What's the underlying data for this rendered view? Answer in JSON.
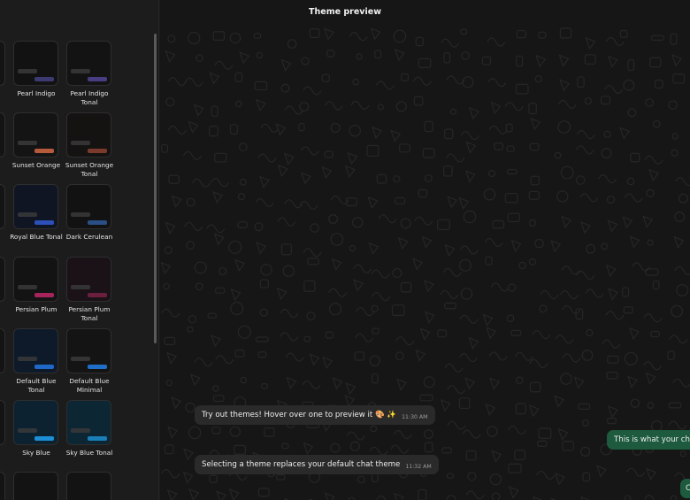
{
  "header": {
    "title": "Theme preview"
  },
  "themes": [
    {
      "label": "Pearl Indigo",
      "label2": "",
      "bg": "#121212",
      "accent": "#3d3a72",
      "col": 1,
      "row": 0
    },
    {
      "label": "Pearl Indigo",
      "label2": "Tonal",
      "bg": "#131313",
      "accent": "#463e80",
      "col": 2,
      "row": 0
    },
    {
      "label": "Sunset Orange",
      "label2": "",
      "bg": "#141414",
      "accent": "#b55a3b",
      "col": 1,
      "row": 1
    },
    {
      "label": "Sunset Orange",
      "label2": "Tonal",
      "bg": "#151212",
      "accent": "#7a3b2c",
      "col": 2,
      "row": 1
    },
    {
      "label": "Royal Blue Tonal",
      "label2": "",
      "bg": "#101524",
      "accent": "#2c4fb8",
      "col": 1,
      "row": 2
    },
    {
      "label": "Dark Cerulean",
      "label2": "",
      "bg": "#121212",
      "accent": "#2a4f85",
      "col": 2,
      "row": 2
    },
    {
      "label": "Persian Plum",
      "label2": "",
      "bg": "#131313",
      "accent": "#a5245c",
      "col": 1,
      "row": 3
    },
    {
      "label": "Persian Plum",
      "label2": "Tonal",
      "bg": "#1a1216",
      "accent": "#6a1f3e",
      "col": 2,
      "row": 3
    },
    {
      "label": "Default Blue",
      "label2": "Tonal",
      "bg": "#0e1a2a",
      "accent": "#1f67c8",
      "col": 1,
      "row": 4
    },
    {
      "label": "Default Blue",
      "label2": "Minimal",
      "bg": "#141414",
      "accent": "#1f6fc8",
      "col": 2,
      "row": 4
    },
    {
      "label": "Sky Blue",
      "label2": "",
      "bg": "#0d2230",
      "accent": "#1d8fd6",
      "col": 1,
      "row": 5
    },
    {
      "label": "Sky Blue Tonal",
      "label2": "",
      "bg": "#0d2634",
      "accent": "#1a7fb8",
      "col": 2,
      "row": 5
    },
    {
      "label": "",
      "label2": "",
      "bg": "#131313",
      "accent": "#131313",
      "col": 1,
      "row": 6
    },
    {
      "label": "",
      "label2": "",
      "bg": "#131313",
      "accent": "#131313",
      "col": 2,
      "row": 6
    }
  ],
  "partial_labels": [
    "",
    "e",
    "",
    "m",
    "",
    "",
    ""
  ],
  "messages": [
    {
      "text": "Try out themes! Hover over one to preview it 🎨 ✨",
      "time": "11:30 AM",
      "direction": "in"
    },
    {
      "text": "This is what your chat",
      "time": "",
      "direction": "out"
    },
    {
      "text": "Selecting a theme replaces your default chat theme",
      "time": "11:32 AM",
      "direction": "in"
    },
    {
      "text": "C",
      "time": "",
      "direction": "out"
    }
  ]
}
